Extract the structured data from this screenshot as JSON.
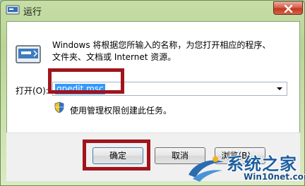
{
  "window": {
    "title": "运行",
    "close_icon": "close-icon"
  },
  "dialog": {
    "icon": "run-icon",
    "description_line1": "Windows 将根据您所输入的名称，为您打开相应的程序、",
    "description_line2": "文件夹、文档或 Internet 资源。",
    "open_label": "打开(O):",
    "open_value": "gpedit.msc",
    "admin_icon": "shield-icon",
    "admin_note": "使用管理权限创建此任务。"
  },
  "buttons": {
    "ok": "确定",
    "cancel": "取消",
    "browse": "浏览(B)..."
  },
  "watermark": {
    "title": "系统之家",
    "url": "Win10net.com"
  },
  "colors": {
    "highlight": "#a0141c",
    "selection": "#3399ff",
    "frame": "#b8d595"
  }
}
